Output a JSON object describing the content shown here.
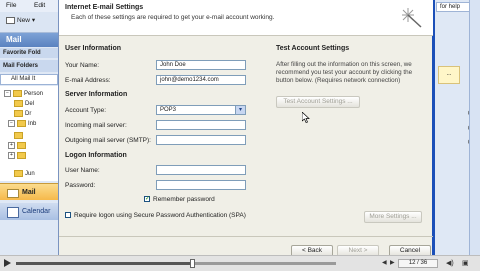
{
  "background": {
    "menu": [
      "File",
      "Edit"
    ],
    "toolbar_new": "New",
    "mail_header": "Mail",
    "favorite_folders": "Favorite Fold",
    "mail_folders": "Mail Folders",
    "all_mail": "All Mail It",
    "tree": [
      "Person",
      "Del",
      "Dr",
      "Inb",
      "Jun"
    ],
    "nav_mail": "Mail",
    "nav_calendar": "Calendar",
    "help_box": "for help",
    "right_numbers": [
      "0",
      "0",
      "0"
    ]
  },
  "dialog": {
    "title": "Internet E-mail Settings",
    "subtitle": "Each of these settings are required to get your e-mail account working.",
    "user_info": {
      "heading": "User Information",
      "name_label": "Your Name:",
      "name_value": "John Doe",
      "email_label": "E-mail Address:",
      "email_value": "john@demo1234.com"
    },
    "server_info": {
      "heading": "Server Information",
      "account_type_label": "Account Type:",
      "account_type_value": "POP3",
      "incoming_label": "Incoming mail server:",
      "incoming_value": "",
      "outgoing_label": "Outgoing mail server (SMTP):",
      "outgoing_value": ""
    },
    "logon_info": {
      "heading": "Logon Information",
      "user_label": "User Name:",
      "user_value": "",
      "password_label": "Password:",
      "password_value": "",
      "remember_label": "Remember password",
      "remember_checked": true,
      "spa_label": "Require logon using Secure Password Authentication (SPA)",
      "spa_checked": false
    },
    "test_settings": {
      "heading": "Test Account Settings",
      "description": "After filling out the information on this screen, we recommend you test your account by clicking the button below. (Requires network connection)",
      "test_button": "Test Account Settings ..."
    },
    "more_settings_button": "More Settings ...",
    "back_button": "< Back",
    "next_button": "Next >",
    "cancel_button": "Cancel"
  },
  "player": {
    "counter": "12 / 36",
    "progress": 0.55
  }
}
